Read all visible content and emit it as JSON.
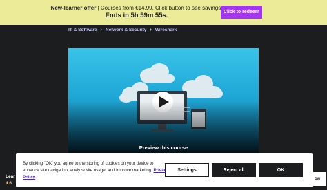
{
  "promo": {
    "strong": "New-learner offer",
    "text": " | Courses from €14.99. Click button to see savings.",
    "countdown": "Ends in 5h 59m 55s.",
    "button_label": "Click to redeem"
  },
  "breadcrumb": {
    "items": [
      "IT & Software",
      "Network & Security",
      "Wireshark"
    ]
  },
  "preview": {
    "title": "Preview this course"
  },
  "cookie": {
    "text": "By clicking \"OK\" you agree to the storing of cookies on your device to enhance site navigation, analyze site usage, and improve marketing. ",
    "link_label": "Privacy Policy",
    "settings_label": "Settings",
    "reject_label": "Reject all",
    "ok_label": "OK"
  },
  "sticky": {
    "title_partial": "Lear",
    "rating_partial": "4.6",
    "button_partial": "ow"
  },
  "colors": {
    "promo_bg": "#eceb98",
    "accent": "#a435f0",
    "page_bg": "#1c1d1f"
  }
}
